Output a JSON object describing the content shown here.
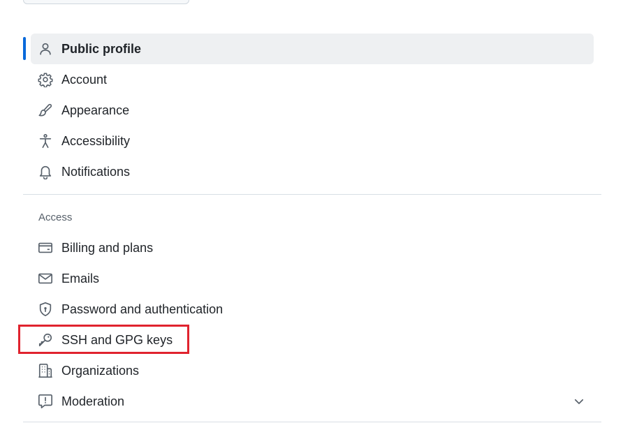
{
  "nav": {
    "items": [
      {
        "label": "Public profile",
        "icon": "person-icon",
        "active": true
      },
      {
        "label": "Account",
        "icon": "gear-icon"
      },
      {
        "label": "Appearance",
        "icon": "paintbrush-icon"
      },
      {
        "label": "Accessibility",
        "icon": "accessibility-icon"
      },
      {
        "label": "Notifications",
        "icon": "bell-icon"
      }
    ],
    "access_section_title": "Access",
    "access_items": [
      {
        "label": "Billing and plans",
        "icon": "credit-card-icon"
      },
      {
        "label": "Emails",
        "icon": "mail-icon"
      },
      {
        "label": "Password and authentication",
        "icon": "shield-lock-icon"
      },
      {
        "label": "SSH and GPG keys",
        "icon": "key-icon"
      },
      {
        "label": "Organizations",
        "icon": "organization-icon"
      },
      {
        "label": "Moderation",
        "icon": "report-icon",
        "expandable": true
      }
    ]
  },
  "colors": {
    "accent": "#0969da",
    "highlight": "#e0232e",
    "active_bg": "#eef0f2"
  }
}
